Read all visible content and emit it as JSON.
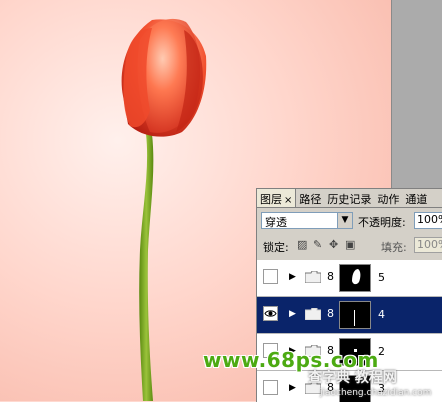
{
  "panel": {
    "tabs": [
      {
        "label": "图层",
        "close": "×",
        "active": true
      },
      {
        "label": "路径"
      },
      {
        "label": "历史记录"
      },
      {
        "label": "动作"
      },
      {
        "label": "通道"
      }
    ],
    "blend_mode": "穿透",
    "opacity_label": "不透明度:",
    "opacity_value": "100%",
    "lock_label": "锁定:",
    "fill_label": "填充:",
    "fill_value": "100%"
  },
  "layers": [
    {
      "name": "5",
      "visible": false,
      "selected": false
    },
    {
      "name": "4",
      "visible": true,
      "selected": true
    },
    {
      "name": "2",
      "visible": false,
      "selected": false
    },
    {
      "name": "3",
      "visible": false,
      "selected": false
    }
  ],
  "watermarks": {
    "site": "www.68ps.com",
    "cn": "查字典 教程网",
    "url": "jiaocheng.chazidian.com"
  },
  "colors": {
    "selected_row": "#0a246a",
    "panel_bg": "#d4d0c8",
    "tulip_red": "#e8422a",
    "stem_green": "#6e9a1c"
  }
}
